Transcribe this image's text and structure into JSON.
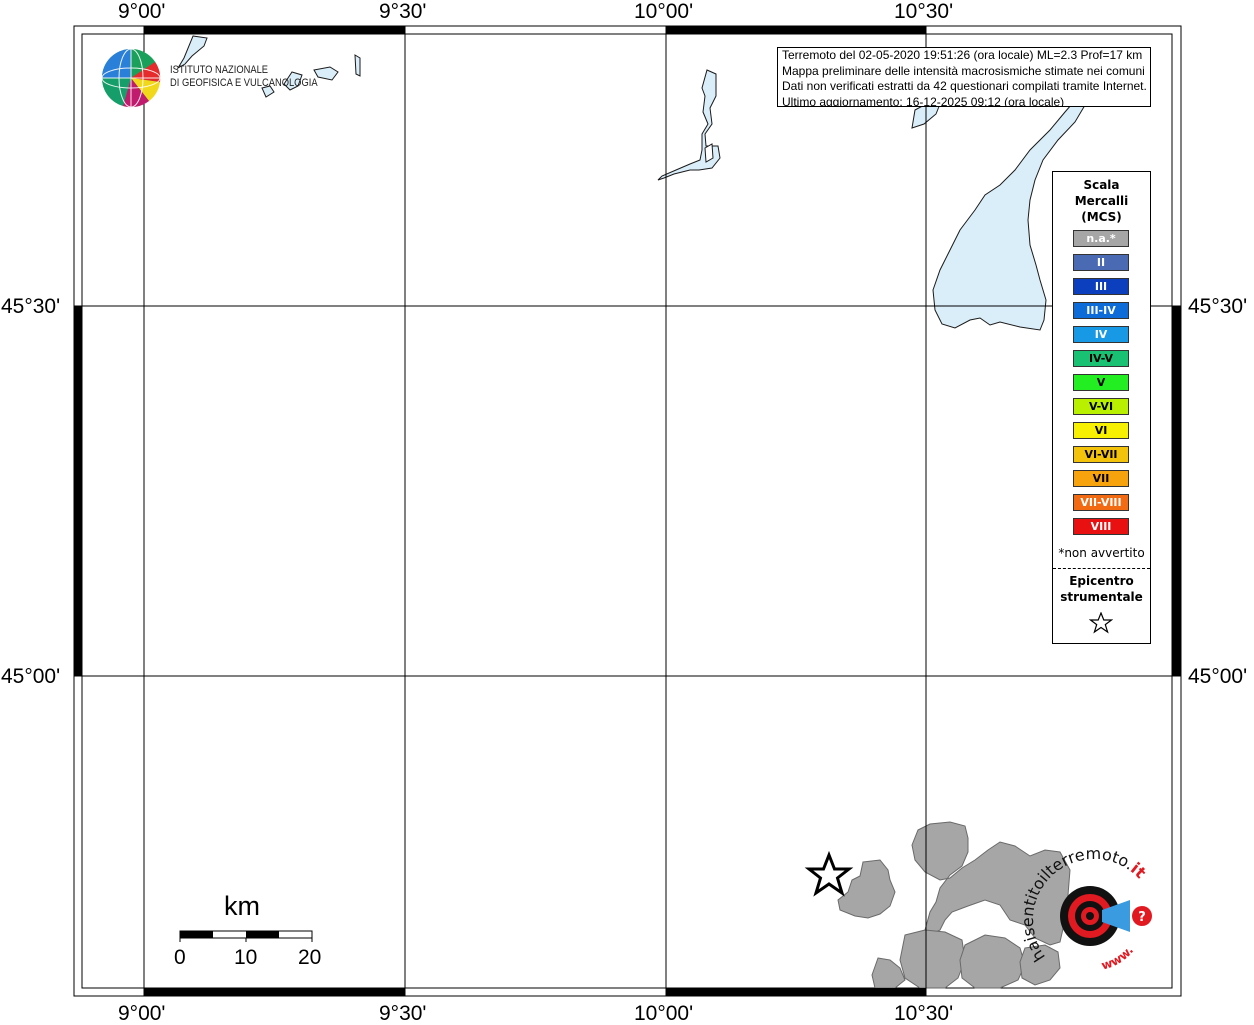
{
  "map": {
    "lon_labels": [
      "9°00'",
      "9°30'",
      "10°00'",
      "10°30'"
    ],
    "lat_labels": [
      "45°30'",
      "45°00'"
    ]
  },
  "info": {
    "line1": "Terremoto del 02-05-2020 19:51:26 (ora locale) ML=2.3 Prof=17 km",
    "line2": "Mappa preliminare delle intensità macrosismiche stimate nei comuni",
    "line3": "Dati non verificati estratti da 42 questionari compilati tramite Internet.",
    "line4": "Ultimo aggiornamento: 16-12-2025 09:12 (ora locale)"
  },
  "logo": {
    "line1": "ISTITUTO NAZIONALE",
    "line2": "DI GEOFISICA E VULCANOLOGIA"
  },
  "legend": {
    "title1": "Scala",
    "title2": "Mercalli",
    "title3": "(MCS)",
    "items": [
      {
        "label": "n.a.*",
        "color": "#a6a6a6",
        "text_color": "#ffffff"
      },
      {
        "label": "II",
        "color": "#4a6ab4",
        "text_color": "#ffffff"
      },
      {
        "label": "III",
        "color": "#0b3fbe",
        "text_color": "#ffffff"
      },
      {
        "label": "III-IV",
        "color": "#0e6cd9",
        "text_color": "#ffffff"
      },
      {
        "label": "IV",
        "color": "#1899e6",
        "text_color": "#ffffff"
      },
      {
        "label": "IV-V",
        "color": "#19c272",
        "text_color": "#000000"
      },
      {
        "label": "V",
        "color": "#22ee22",
        "text_color": "#000000"
      },
      {
        "label": "V-VI",
        "color": "#b8f000",
        "text_color": "#000000"
      },
      {
        "label": "VI",
        "color": "#f7f000",
        "text_color": "#000000"
      },
      {
        "label": "VI-VII",
        "color": "#f2c30a",
        "text_color": "#000000"
      },
      {
        "label": "VII",
        "color": "#f7a30d",
        "text_color": "#000000"
      },
      {
        "label": "VII-VIII",
        "color": "#f26a12",
        "text_color": "#ffffff"
      },
      {
        "label": "VIII",
        "color": "#e81010",
        "text_color": "#ffffff"
      }
    ],
    "na_note": "*non avvertito",
    "epi1": "Epicentro",
    "epi2": "strumentale"
  },
  "scale_bar": {
    "unit": "km",
    "ticks": [
      "0",
      "10",
      "20"
    ]
  },
  "watermark": {
    "text_main": "haisentitoilterremoto.",
    "text_it": "it",
    "text_www": "www."
  },
  "colors": {
    "water": "#daeefa",
    "felt_area": "#a6a6a6",
    "frame": "#000000",
    "accent_red": "#e11a22"
  }
}
